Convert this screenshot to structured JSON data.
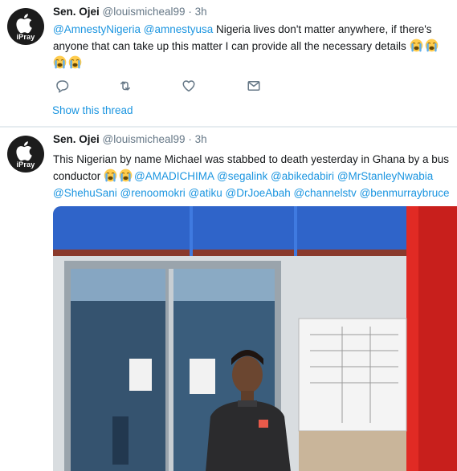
{
  "tweets": [
    {
      "name": "Sen. Ojei",
      "handle": "@louismicheal99",
      "dot": "·",
      "time": "3h",
      "avatar_label": "iPray",
      "mention_1": "@AmnestyNigeria",
      "mention_2": "@amnestyusa",
      "body": " Nigeria lives don't matter anywhere, if there's anyone that can take up this matter I can provide all the necessary details ",
      "show_thread": "Show this thread",
      "actions": [
        "reply-icon",
        "retweet-icon",
        "like-icon",
        "message-icon"
      ]
    },
    {
      "name": "Sen. Ojei",
      "handle": "@louismicheal99",
      "dot": "·",
      "time": "3h",
      "avatar_label": "iPray",
      "body": "This Nigerian by name Michael was stabbed to death yesterday in Ghana by a bus conductor ",
      "mentions": [
        "@AMADICHIMA",
        "@segalink",
        "@abikedabiri",
        "@MrStanleyNwabia",
        "@ShehuSani",
        "@renoomokri",
        "@atiku",
        "@DrJoeAbah",
        "@channelstv",
        "@benmurraybruce"
      ]
    }
  ],
  "colors": {
    "link": "#1b95e0",
    "muted": "#657786",
    "text": "#14171a",
    "divider": "#e6ecf0"
  }
}
